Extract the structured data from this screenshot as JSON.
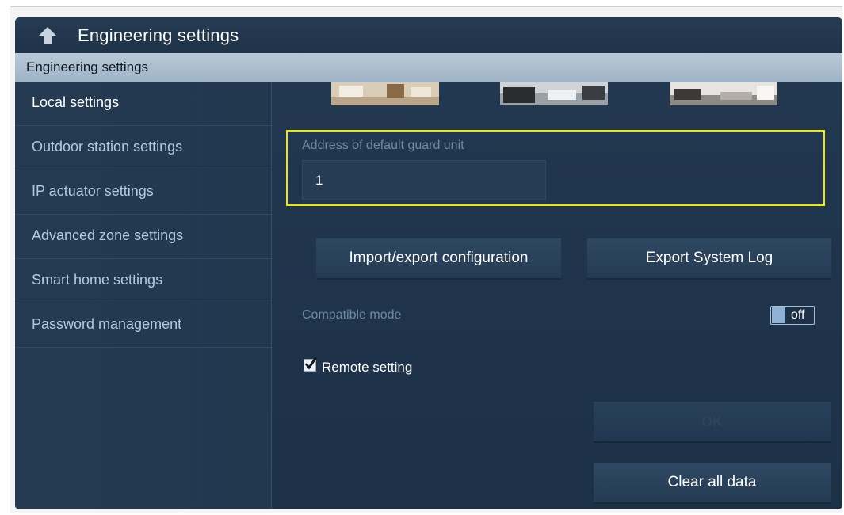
{
  "header": {
    "title": "Engineering settings",
    "back_icon": "back-arrow-icon"
  },
  "section": {
    "title": "Engineering settings"
  },
  "sidebar": {
    "items": [
      {
        "label": "Local settings",
        "active": true
      },
      {
        "label": "Outdoor station settings",
        "active": false
      },
      {
        "label": "IP actuator settings",
        "active": false
      },
      {
        "label": "Advanced zone settings",
        "active": false
      },
      {
        "label": "Smart home settings",
        "active": false
      },
      {
        "label": "Password management",
        "active": false
      }
    ]
  },
  "content": {
    "guard_unit": {
      "label": "Address of default guard unit",
      "value": "1"
    },
    "buttons": {
      "import_export": "Import/export configuration",
      "export_log": "Export System Log",
      "ok": "OK",
      "clear": "Clear all data"
    },
    "compatible_mode": {
      "label": "Compatible mode",
      "state": "off"
    },
    "remote_setting": {
      "label": "Remote setting",
      "checked": true
    }
  },
  "colors": {
    "highlight": "#f2e600",
    "background": "#1f3247",
    "accent": "#8fb2d4"
  }
}
